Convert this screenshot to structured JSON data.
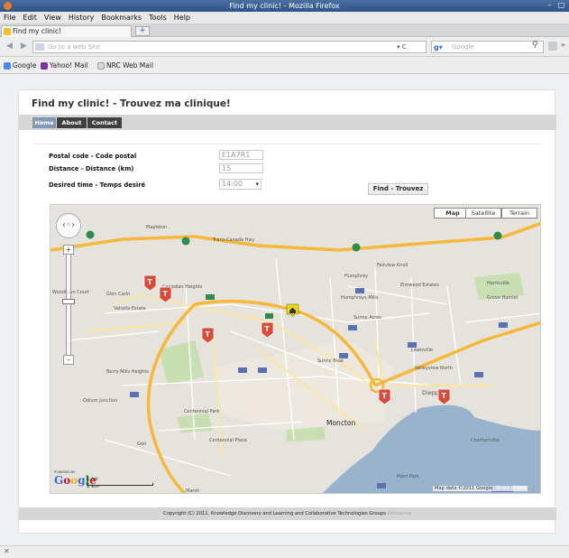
{
  "window": {
    "title": "Find my clinic! - Mozilla Firefox"
  },
  "menu": [
    "File",
    "Edit",
    "View",
    "History",
    "Bookmarks",
    "Tools",
    "Help"
  ],
  "tab": {
    "label": "Find my clinic!",
    "new_tab": "+"
  },
  "navbar": {
    "url_placeholder": "Go to a web Site",
    "search_engine": "Google",
    "search_placeholder": "Google",
    "reload": "▾ C"
  },
  "bookmarks": [
    {
      "label": "Google",
      "color": "#4a8ae8"
    },
    {
      "label": "Yahoo! Mail",
      "color": "#7b2fa8"
    },
    {
      "label": "NRC Web Mail",
      "color": "#d8d8d8"
    }
  ],
  "site": {
    "title": "Find my clinic! - Trouvez ma clinique!",
    "nav": [
      "Home",
      "About",
      "Contact"
    ]
  },
  "form": {
    "postal_label": "Postal code - Code postal",
    "postal_value": "E1A7R1",
    "distance_label": "Distance - Distance (km)",
    "distance_value": "15",
    "time_label": "Desired time - Temps desiré",
    "time_value": "14:00",
    "submit": "Find - Trouvez"
  },
  "map": {
    "types": [
      "Map",
      "Satellite",
      "Terrain"
    ],
    "selected_type": "Map",
    "places": [
      "Mapleton",
      "Trans-Canada Hwy",
      "Fairview Knoll",
      "Humphrey",
      "Elmwood Estates",
      "Humphreys Mills",
      "Sunny Acres",
      "Harrisville",
      "Grove Hamlet",
      "Woodlawn Court",
      "Glen Carin",
      "Canadian Heights",
      "Vahalla Estate",
      "Sunny Brae",
      "Lewisville",
      "Berry Mills Heights",
      "Valleyview North",
      "Dieppe",
      "Odium Junction",
      "Centennial Park",
      "Moncton",
      "Centennial Place",
      "Chartersville",
      "Gorl",
      "Point Park",
      "Marsh"
    ],
    "powered_by": "POWERED BY",
    "logo": "Google",
    "scale_mi": "1 mi",
    "scale_km": "1 km",
    "attribution": "Map data ©2011 Google",
    "terms_badge": "Terms of Use"
  },
  "footer": {
    "text": "Copyright (C) 2011, Knowledge Discovery and Learning and Collaborative Technologies Groups",
    "muted": "Disclaimer"
  },
  "colors": {
    "marker": "#d94a3a",
    "highway": "#f5b83c",
    "road": "#fde6a0",
    "water": "#99b3cc",
    "park": "#c7dfb2",
    "nav_active": "#8497b0"
  }
}
